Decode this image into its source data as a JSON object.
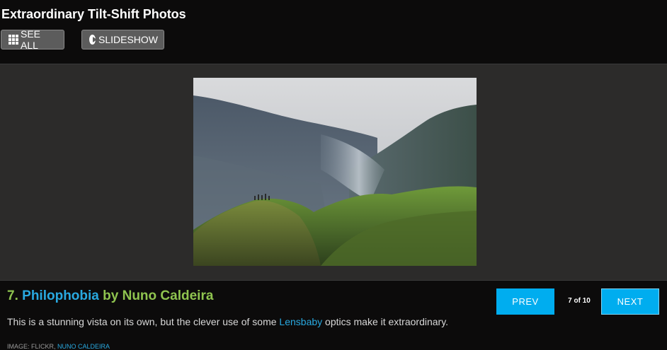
{
  "gallery": {
    "title": "Extraordinary Tilt-Shift Photos",
    "see_all_label": "SEE ALL",
    "slideshow_label": "SLIDESHOW"
  },
  "slide": {
    "number": "7.",
    "title": "Philophobia",
    "by": "by",
    "author": "Nuno Caldeira",
    "description_before": "This is a stunning vista on its own, but the clever use of some",
    "description_link": "Lensbaby",
    "description_after": "optics make it extraordinary.",
    "credit_prefix": "IMAGE: FLICKR,",
    "credit_name": "NUNO CALDEIRA"
  },
  "pager": {
    "current": "7",
    "of": "of",
    "total": "10",
    "prev_label": "PREV",
    "next_label": "NEXT"
  },
  "icons": {
    "see_all": "grid-icon",
    "slideshow": "play-circle-icon"
  },
  "colors": {
    "accent_blue": "#29a9e0",
    "button_blue": "#00adef",
    "accent_green": "#8fc44f",
    "background": "#0c0b0b",
    "stage": "#2c2b2a"
  }
}
